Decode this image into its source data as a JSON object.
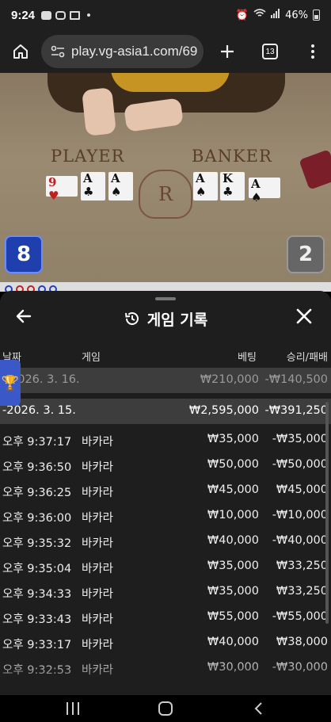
{
  "status_bar": {
    "time": "9:24",
    "battery": "46%"
  },
  "browser": {
    "url": "play.vg-asia1.com/69",
    "tab_count": "13"
  },
  "game": {
    "player_label": "PLAYER",
    "banker_label": "BANKER",
    "player_score": "8",
    "banker_score": "2",
    "crest_letter": "R",
    "player_cards": [
      {
        "rank": "9",
        "suit": "♥",
        "color": "red"
      },
      {
        "rank": "A",
        "suit": "♣",
        "color": "black"
      },
      {
        "rank": "A",
        "suit": "♠",
        "color": "black"
      }
    ],
    "banker_cards": [
      {
        "rank": "A",
        "suit": "♠",
        "color": "black"
      },
      {
        "rank": "K",
        "suit": "♣",
        "color": "black"
      },
      {
        "rank": "A",
        "suit": "♠",
        "color": "black"
      }
    ]
  },
  "history": {
    "title": "게임 기록",
    "columns": {
      "date": "날짜",
      "game": "게임",
      "bet": "베팅",
      "result": "승리/패배"
    },
    "date_rows": [
      {
        "date": "2026. 3. 16.",
        "bet": "₩210,000",
        "result": "-₩140,500"
      },
      {
        "date": "-2026. 3. 15.",
        "bet": "₩2,595,000",
        "result": "-₩391,250"
      }
    ],
    "items": [
      {
        "time": "오후 9:37:17",
        "game": "바카라",
        "bet": "₩35,000",
        "result": "-₩35,000"
      },
      {
        "time": "오후 9:36:50",
        "game": "바카라",
        "bet": "₩50,000",
        "result": "-₩50,000"
      },
      {
        "time": "오후 9:36:25",
        "game": "바카라",
        "bet": "₩45,000",
        "result": "₩45,000"
      },
      {
        "time": "오후 9:36:00",
        "game": "바카라",
        "bet": "₩10,000",
        "result": "-₩10,000"
      },
      {
        "time": "오후 9:35:32",
        "game": "바카라",
        "bet": "₩40,000",
        "result": "-₩40,000"
      },
      {
        "time": "오후 9:35:04",
        "game": "바카라",
        "bet": "₩35,000",
        "result": "₩33,250"
      },
      {
        "time": "오후 9:34:33",
        "game": "바카라",
        "bet": "₩35,000",
        "result": "₩33,250"
      },
      {
        "time": "오후 9:33:43",
        "game": "바카라",
        "bet": "₩55,000",
        "result": "-₩55,000"
      },
      {
        "time": "오후 9:33:17",
        "game": "바카라",
        "bet": "₩40,000",
        "result": "₩38,000"
      },
      {
        "time": "오후 9:32:53",
        "game": "바카라",
        "bet": "₩30,000",
        "result": "-₩30,000"
      }
    ]
  }
}
